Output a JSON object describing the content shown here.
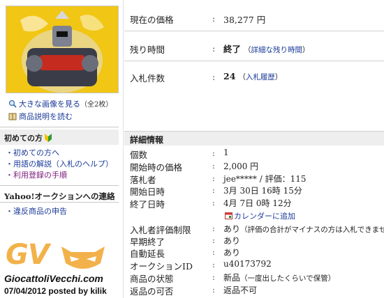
{
  "left": {
    "enlarge_link": "大きな画像を見る",
    "enlarge_count": "（全2枚）",
    "description_link": "商品説明を読む",
    "first_time_header": "初めての方",
    "first_time_links": [
      "初めての方へ",
      "用語の解説（入札のヘルプ）",
      "利用登録の手順"
    ],
    "contact_header": "Yahoo!オークションへの連絡",
    "contact_links": [
      "違反商品の申告"
    ]
  },
  "summary": {
    "price_label": "現在の価格",
    "price_value": "38,277 円",
    "remaining_label": "残り時間",
    "remaining_value": "終了",
    "remaining_detail_link": "詳細な残り時間",
    "bids_label": "入札件数",
    "bids_value": "24",
    "bid_history_link": "入札履歴"
  },
  "details": {
    "header": "詳細情報",
    "rows": [
      {
        "label": "個数",
        "value": "1"
      },
      {
        "label": "開始時の価格",
        "value": "2,000 円"
      },
      {
        "label": "落札者",
        "value": "jee***** / 評価：115"
      },
      {
        "label": "開始日時",
        "value": "3月 30日 16時 15分"
      },
      {
        "label": "終了日時",
        "value": "4月 7日 0時 12分"
      },
      {
        "label": "入札者評価制限",
        "value": "あり",
        "note": "（評価の合計がマイナスの方は入札できません）"
      },
      {
        "label": "早期終了",
        "value": "あり"
      },
      {
        "label": "自動延長",
        "value": "あり"
      },
      {
        "label": "オークションID",
        "value": "u40173792"
      },
      {
        "label": "商品の状態",
        "value": "新品",
        "note": "（一度出したくらいで保管）"
      },
      {
        "label": "返品の可否",
        "value": "返品不可"
      }
    ],
    "calendar_link": "カレンダーに追加"
  },
  "watermark": {
    "logo": "GV",
    "site": "GiocattoliVecchi.com",
    "posted": "07/04/2012 posted by kilik"
  },
  "colors": {
    "link": "#1a3a99",
    "visited": "#7a1a7a",
    "header_bg": "#eeeeee",
    "logo_orange": "#f2b14a"
  }
}
